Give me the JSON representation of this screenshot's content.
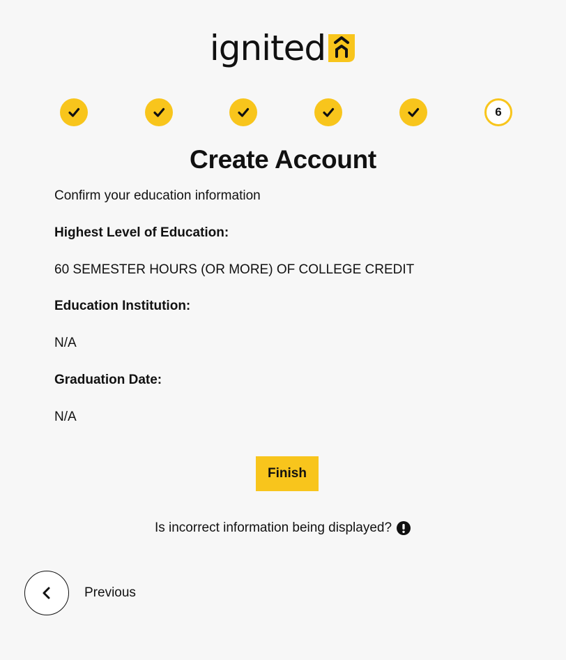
{
  "header": {
    "logo_text": "ignited",
    "brand_color": "#f8c51c"
  },
  "stepper": {
    "steps": [
      {
        "status": "complete",
        "icon": "check-icon"
      },
      {
        "status": "complete",
        "icon": "check-icon"
      },
      {
        "status": "complete",
        "icon": "check-icon"
      },
      {
        "status": "complete",
        "icon": "check-icon"
      },
      {
        "status": "complete",
        "icon": "check-icon"
      },
      {
        "status": "current",
        "label": "6"
      }
    ]
  },
  "main": {
    "title": "Create Account",
    "intro": "Confirm your education information",
    "education_level_label": "Highest Level of Education:",
    "education_level_value": "60 SEMESTER HOURS (OR MORE) OF COLLEGE CREDIT",
    "institution_label": "Education Institution:",
    "institution_value": "N/A",
    "graduation_label": "Graduation Date:",
    "graduation_value": "N/A",
    "finish_label": "Finish",
    "incorrect_info_text": "Is incorrect information being displayed?",
    "incorrect_info_icon": "exclamation-circle-icon"
  },
  "footer": {
    "previous_label": "Previous",
    "previous_icon": "chevron-left-icon"
  }
}
